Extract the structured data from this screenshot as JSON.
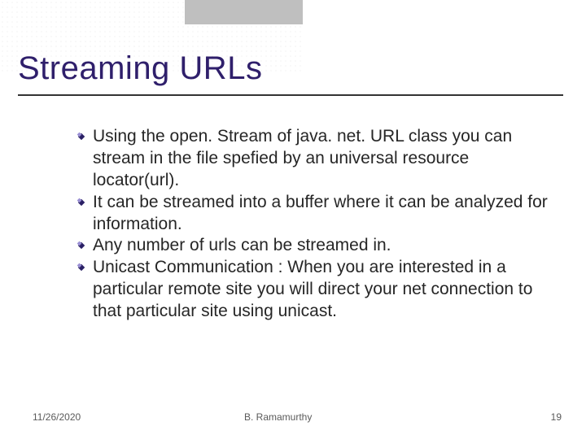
{
  "title": "Streaming URLs",
  "bullets": [
    "Using the open. Stream of java. net. URL class you can stream in the file spefied by an universal resource locator(url).",
    "It can be streamed into a buffer where it can be analyzed for information.",
    "Any number of urls can be streamed in.",
    "Unicast Communication : When you are interested in a particular remote site you will direct your net connection to that particular site using unicast."
  ],
  "footer": {
    "date": "11/26/2020",
    "author": "B. Ramamurthy",
    "page": "19"
  },
  "colors": {
    "title": "#2f1f6b",
    "bullet_dark": "#2a2065",
    "bullet_light": "#8a7fc9"
  }
}
